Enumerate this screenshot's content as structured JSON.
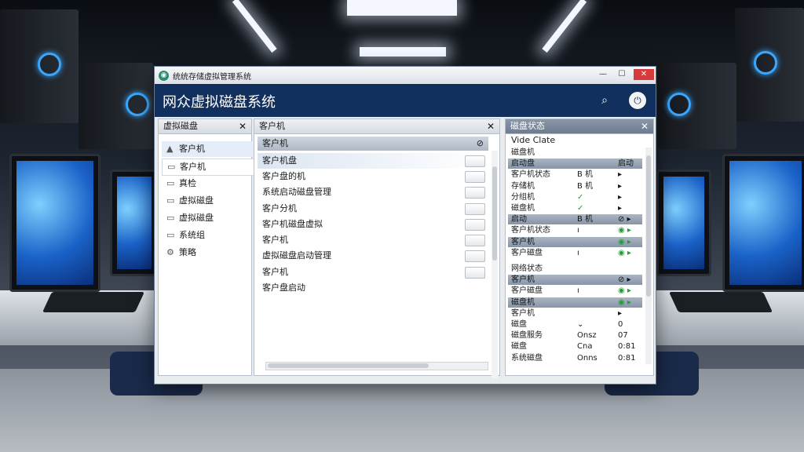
{
  "window": {
    "title": "统统存储虚拟管理系统",
    "min_label": "—",
    "max_label": "☐",
    "close_label": "✕"
  },
  "header": {
    "app_title": "网众虚拟磁盘系统",
    "search_icon": "search-icon",
    "user_icon": "user-icon"
  },
  "sidebar": {
    "title": "虚拟磁盘",
    "close_label": "✕",
    "items": [
      {
        "label": "客户机",
        "icon": "warning-icon",
        "glyph": "▲"
      },
      {
        "label": "客户机",
        "icon": "doc-icon",
        "glyph": "▭"
      },
      {
        "label": "真检",
        "icon": "doc-icon",
        "glyph": "▭"
      },
      {
        "label": "虚拟磁盘",
        "icon": "doc-icon",
        "glyph": "▭"
      },
      {
        "label": "虚拟磁盘",
        "icon": "doc-icon",
        "glyph": "▭"
      },
      {
        "label": "系统组",
        "icon": "monitor-icon",
        "glyph": "▭"
      },
      {
        "label": "策略",
        "icon": "tools-icon",
        "glyph": "⚙"
      }
    ]
  },
  "main": {
    "title": "客户机",
    "close_label": "✕",
    "subheader": "客户机",
    "tool_label": "⊘",
    "rows": [
      "客户机盘",
      "客户盘的机",
      "系统启动磁盘管理",
      "客户分机",
      "客户机磁盘虚拟",
      "客户机",
      "虚拟磁盘启动管理",
      "客户机",
      "客户盘启动"
    ]
  },
  "right": {
    "title": "磁盘状态",
    "close_label": "✕",
    "subtitle": "Vide Clate",
    "rows": [
      {
        "kind": "plain",
        "name": "磁盘机",
        "a": "",
        "b": ""
      },
      {
        "kind": "sec",
        "name": "启动盘",
        "a": "",
        "b": "启动"
      },
      {
        "kind": "plain",
        "name": "客户机状态",
        "a": "B 机",
        "b": "▸"
      },
      {
        "kind": "plain",
        "name": "存储机",
        "a": "B 机",
        "b": "▸"
      },
      {
        "kind": "plain",
        "name": "分组机",
        "a": "✓",
        "b": "▸"
      },
      {
        "kind": "plain",
        "name": "磁盘机",
        "a": "✓",
        "b": "▸"
      },
      {
        "kind": "sec",
        "name": "启动",
        "a": "B 机",
        "b": "⊘ ▸"
      },
      {
        "kind": "plain",
        "name": "客户机状态",
        "a": "ı",
        "b": "◉ ▸"
      },
      {
        "kind": "sec",
        "name": "客户机",
        "a": "",
        "b": "◉ ▸"
      },
      {
        "kind": "plain",
        "name": "客户磁盘",
        "a": "ı",
        "b": "◉ ▸"
      },
      {
        "kind": "gap",
        "name": "",
        "a": "",
        "b": ""
      },
      {
        "kind": "plain",
        "name": "网络状态",
        "a": "",
        "b": ""
      },
      {
        "kind": "sec",
        "name": "客户机",
        "a": "",
        "b": "⊘ ▸"
      },
      {
        "kind": "plain",
        "name": "客户磁盘",
        "a": "ı",
        "b": "◉ ▸"
      },
      {
        "kind": "sec",
        "name": "磁盘机",
        "a": "",
        "b": "◉ ▸"
      },
      {
        "kind": "plain",
        "name": "客户机",
        "a": "",
        "b": "▸"
      },
      {
        "kind": "plain",
        "name": "磁盘",
        "a": "⌄",
        "b": "0"
      },
      {
        "kind": "plain",
        "name": "磁盘服务",
        "a": "Onsz",
        "b": "07"
      },
      {
        "kind": "plain",
        "name": "磁盘",
        "a": "Cna",
        "b": "0:81"
      },
      {
        "kind": "plain",
        "name": "系统磁盘",
        "a": "Onns",
        "b": "0:81"
      }
    ]
  }
}
